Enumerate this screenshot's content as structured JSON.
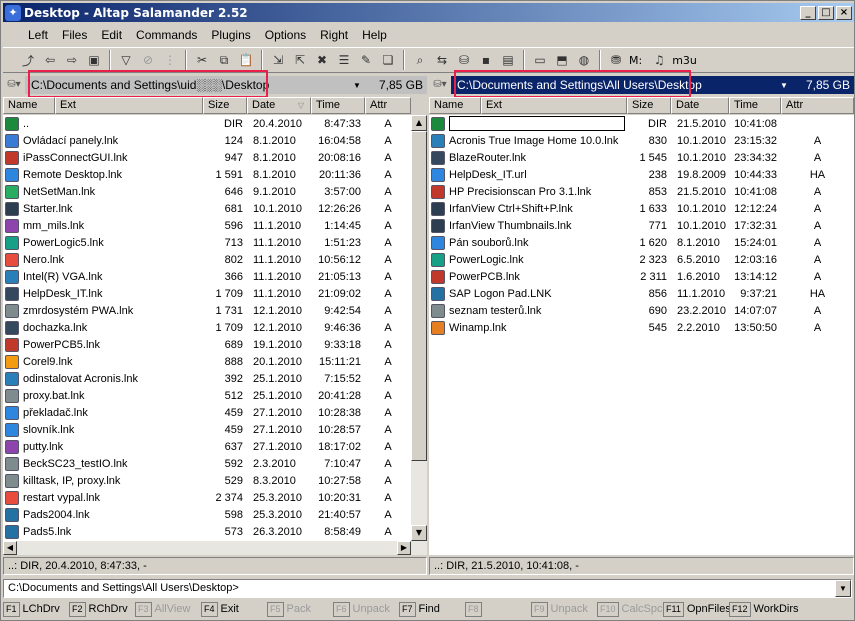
{
  "window": {
    "title": "Desktop - Altap Salamander 2.52",
    "minimize": "_",
    "maximize": "□",
    "close": "×"
  },
  "menu": [
    {
      "label": "Left"
    },
    {
      "label": "Files"
    },
    {
      "label": "Edit"
    },
    {
      "label": "Commands"
    },
    {
      "label": "Plugins"
    },
    {
      "label": "Options"
    },
    {
      "label": "Right"
    },
    {
      "label": "Help"
    }
  ],
  "toolbar": {
    "m_label": "M:",
    "m3u_label": "m3u"
  },
  "left": {
    "path": "C:\\Documents and Settings\\uid░░░\\Desktop",
    "free": "7,85 GB",
    "columns": {
      "name": "Name",
      "ext": "Ext",
      "size": "Size",
      "date": "Date",
      "time": "Time",
      "attr": "Attr"
    },
    "rows": [
      {
        "name": "..",
        "size": "DIR",
        "date": "20.4.2010",
        "time": "8:47:33",
        "attr": "A",
        "icon": "up-dir-icon",
        "color": "#1c8a3c"
      },
      {
        "name": "Ovládací panely.lnk",
        "size": "124",
        "date": "8.1.2010",
        "time": "16:04:58",
        "attr": "A",
        "icon": "control-panel-icon",
        "color": "#3a7bd5"
      },
      {
        "name": "iPassConnectGUI.lnk",
        "size": "947",
        "date": "8.1.2010",
        "time": "20:08:16",
        "attr": "A",
        "icon": "ipass-icon",
        "color": "#c0392b"
      },
      {
        "name": "Remote Desktop.lnk",
        "size": "1 591",
        "date": "8.1.2010",
        "time": "20:11:36",
        "attr": "A",
        "icon": "remote-desktop-icon",
        "color": "#2e86de"
      },
      {
        "name": "NetSetMan.lnk",
        "size": "646",
        "date": "9.1.2010",
        "time": "3:57:00",
        "attr": "A",
        "icon": "netsetman-icon",
        "color": "#27ae60"
      },
      {
        "name": "Starter.lnk",
        "size": "681",
        "date": "10.1.2010",
        "time": "12:26:26",
        "attr": "A",
        "icon": "starter-icon",
        "color": "#2c3e50"
      },
      {
        "name": "mm_mils.lnk",
        "size": "596",
        "date": "11.1.2010",
        "time": "1:14:45",
        "attr": "A",
        "icon": "mm-mils-icon",
        "color": "#8e44ad"
      },
      {
        "name": "PowerLogic5.lnk",
        "size": "713",
        "date": "11.1.2010",
        "time": "1:51:23",
        "attr": "A",
        "icon": "powerlogic-icon",
        "color": "#16a085"
      },
      {
        "name": "Nero.lnk",
        "size": "802",
        "date": "11.1.2010",
        "time": "10:56:12",
        "attr": "A",
        "icon": "nero-icon",
        "color": "#e74c3c"
      },
      {
        "name": "Intel(R) VGA.lnk",
        "size": "366",
        "date": "11.1.2010",
        "time": "21:05:13",
        "attr": "A",
        "icon": "intel-vga-icon",
        "color": "#2980b9"
      },
      {
        "name": "HelpDesk_IT.lnk",
        "size": "1 709",
        "date": "11.1.2010",
        "time": "21:09:02",
        "attr": "A",
        "icon": "helpdesk-icon",
        "color": "#34495e"
      },
      {
        "name": "zmrdosystém PWA.lnk",
        "size": "1 731",
        "date": "12.1.2010",
        "time": "9:42:54",
        "attr": "A",
        "icon": "pwa-icon",
        "color": "#7f8c8d"
      },
      {
        "name": "dochazka.lnk",
        "size": "1 709",
        "date": "12.1.2010",
        "time": "9:46:36",
        "attr": "A",
        "icon": "dochazka-icon",
        "color": "#34495e"
      },
      {
        "name": "PowerPCB5.lnk",
        "size": "689",
        "date": "19.1.2010",
        "time": "9:33:18",
        "attr": "A",
        "icon": "powerpcb-icon",
        "color": "#c0392b"
      },
      {
        "name": "Corel9.lnk",
        "size": "888",
        "date": "20.1.2010",
        "time": "15:11:21",
        "attr": "A",
        "icon": "corel-icon",
        "color": "#f39c12"
      },
      {
        "name": "odinstalovat Acronis.lnk",
        "size": "392",
        "date": "25.1.2010",
        "time": "7:15:52",
        "attr": "A",
        "icon": "acronis-uninstall-icon",
        "color": "#2980b9"
      },
      {
        "name": "proxy.bat.lnk",
        "size": "512",
        "date": "25.1.2010",
        "time": "20:41:28",
        "attr": "A",
        "icon": "batch-file-icon",
        "color": "#7f8c8d"
      },
      {
        "name": "překladač.lnk",
        "size": "459",
        "date": "27.1.2010",
        "time": "10:28:38",
        "attr": "A",
        "icon": "translator-icon",
        "color": "#2e86de"
      },
      {
        "name": "slovník.lnk",
        "size": "459",
        "date": "27.1.2010",
        "time": "10:28:57",
        "attr": "A",
        "icon": "dictionary-icon",
        "color": "#2e86de"
      },
      {
        "name": "putty.lnk",
        "size": "637",
        "date": "27.1.2010",
        "time": "18:17:02",
        "attr": "A",
        "icon": "putty-icon",
        "color": "#8e44ad"
      },
      {
        "name": "BeckSC23_testIO.lnk",
        "size": "592",
        "date": "2.3.2010",
        "time": "7:10:47",
        "attr": "A",
        "icon": "beck-icon",
        "color": "#7f8c8d"
      },
      {
        "name": "killtask, IP, proxy.lnk",
        "size": "529",
        "date": "8.3.2010",
        "time": "10:27:58",
        "attr": "A",
        "icon": "killtask-icon",
        "color": "#7f8c8d"
      },
      {
        "name": "restart vypal.lnk",
        "size": "2 374",
        "date": "25.3.2010",
        "time": "10:20:31",
        "attr": "A",
        "icon": "restart-icon",
        "color": "#e74c3c"
      },
      {
        "name": "Pads2004.lnk",
        "size": "598",
        "date": "25.3.2010",
        "time": "21:40:57",
        "attr": "A",
        "icon": "pads-icon",
        "color": "#2471a3"
      },
      {
        "name": "Pads5.lnk",
        "size": "573",
        "date": "26.3.2010",
        "time": "8:58:49",
        "attr": "A",
        "icon": "pads-icon",
        "color": "#2471a3"
      }
    ],
    "status": "..: DIR, 20.4.2010, 8:47:33, -"
  },
  "right": {
    "path": "C:\\Documents and Settings\\All Users\\Desktop",
    "free": "7,85 GB",
    "columns": {
      "name": "Name",
      "ext": "Ext",
      "size": "Size",
      "date": "Date",
      "time": "Time",
      "attr": "Attr"
    },
    "rows": [
      {
        "name": "",
        "size": "DIR",
        "date": "21.5.2010",
        "time": "10:41:08",
        "attr": "",
        "icon": "up-dir-icon",
        "color": "#1c8a3c",
        "editing": true
      },
      {
        "name": "Acronis True Image Home 10.0.lnk",
        "size": "830",
        "date": "10.1.2010",
        "time": "23:15:32",
        "attr": "A",
        "icon": "acronis-icon",
        "color": "#2980b9"
      },
      {
        "name": "BlazeRouter.lnk",
        "size": "1 545",
        "date": "10.1.2010",
        "time": "23:34:32",
        "attr": "A",
        "icon": "blazerouter-icon",
        "color": "#34495e"
      },
      {
        "name": "HelpDesk_IT.url",
        "size": "238",
        "date": "19.8.2009",
        "time": "10:44:33",
        "attr": "HA",
        "icon": "url-icon",
        "color": "#2e86de"
      },
      {
        "name": "HP Precisionscan Pro 3.1.lnk",
        "size": "853",
        "date": "21.5.2010",
        "time": "10:41:08",
        "attr": "A",
        "icon": "hp-scan-icon",
        "color": "#c0392b"
      },
      {
        "name": "IrfanView Ctrl+Shift+P.lnk",
        "size": "1 633",
        "date": "10.1.2010",
        "time": "12:12:24",
        "attr": "A",
        "icon": "irfanview-icon",
        "color": "#2c3e50"
      },
      {
        "name": "IrfanView Thumbnails.lnk",
        "size": "771",
        "date": "10.1.2010",
        "time": "17:32:31",
        "attr": "A",
        "icon": "irfanview-icon",
        "color": "#2c3e50"
      },
      {
        "name": "Pán souborů.lnk",
        "size": "1 620",
        "date": "8.1.2010",
        "time": "15:24:01",
        "attr": "A",
        "icon": "file-manager-icon",
        "color": "#2e86de"
      },
      {
        "name": "PowerLogic.lnk",
        "size": "2 323",
        "date": "6.5.2010",
        "time": "12:03:16",
        "attr": "A",
        "icon": "powerlogic-icon",
        "color": "#16a085"
      },
      {
        "name": "PowerPCB.lnk",
        "size": "2 311",
        "date": "1.6.2010",
        "time": "13:14:12",
        "attr": "A",
        "icon": "powerpcb-icon",
        "color": "#c0392b"
      },
      {
        "name": "SAP Logon Pad.LNK",
        "size": "856",
        "date": "11.1.2010",
        "time": "9:37:21",
        "attr": "HA",
        "icon": "sap-icon",
        "color": "#2471a3"
      },
      {
        "name": "seznam testerů.lnk",
        "size": "690",
        "date": "23.2.2010",
        "time": "14:07:07",
        "attr": "A",
        "icon": "document-icon",
        "color": "#7f8c8d"
      },
      {
        "name": "Winamp.lnk",
        "size": "545",
        "date": "2.2.2010",
        "time": "13:50:50",
        "attr": "A",
        "icon": "winamp-icon",
        "color": "#e67e22"
      }
    ],
    "status": "..: DIR, 21.5.2010, 10:41:08, -"
  },
  "command_line": "C:\\Documents and Settings\\All Users\\Desktop>",
  "fkeys": [
    {
      "key": "F1",
      "label": "LChDrv",
      "enabled": true
    },
    {
      "key": "F2",
      "label": "RChDrv",
      "enabled": true
    },
    {
      "key": "F3",
      "label": "AllView",
      "enabled": false
    },
    {
      "key": "F4",
      "label": "Exit",
      "enabled": true
    },
    {
      "key": "F5",
      "label": "Pack",
      "enabled": false
    },
    {
      "key": "F6",
      "label": "Unpack",
      "enabled": false
    },
    {
      "key": "F7",
      "label": "Find",
      "enabled": true
    },
    {
      "key": "F8",
      "label": "",
      "enabled": false
    },
    {
      "key": "F9",
      "label": "Unpack",
      "enabled": false
    },
    {
      "key": "F10",
      "label": "CalcSpc",
      "enabled": false
    },
    {
      "key": "F11",
      "label": "OpnFiles",
      "enabled": true
    },
    {
      "key": "F12",
      "label": "WorkDirs",
      "enabled": true
    }
  ],
  "highlight_color": "#e8204a"
}
